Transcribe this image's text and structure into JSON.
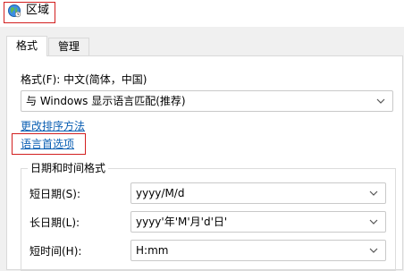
{
  "window": {
    "title": "区域",
    "icon": "globe-region-icon"
  },
  "tabs": [
    {
      "label": "格式",
      "active": true
    },
    {
      "label": "管理",
      "active": false
    }
  ],
  "format": {
    "label": "格式(F): 中文(简体，中国)",
    "selected": "与 Windows 显示语言匹配(推荐)"
  },
  "links": {
    "change_sort": "更改排序方法",
    "language_prefs": "语言首选项"
  },
  "datetime": {
    "group_title": "日期和时间格式",
    "rows": [
      {
        "label": "短日期(S):",
        "value": "yyyy/M/d"
      },
      {
        "label": "长日期(L):",
        "value": "yyyy'年'M'月'd'日'"
      },
      {
        "label": "短时间(H):",
        "value": "H:mm"
      }
    ]
  },
  "colors": {
    "highlight_border": "#d21f1f",
    "link": "#0b5fb3"
  }
}
